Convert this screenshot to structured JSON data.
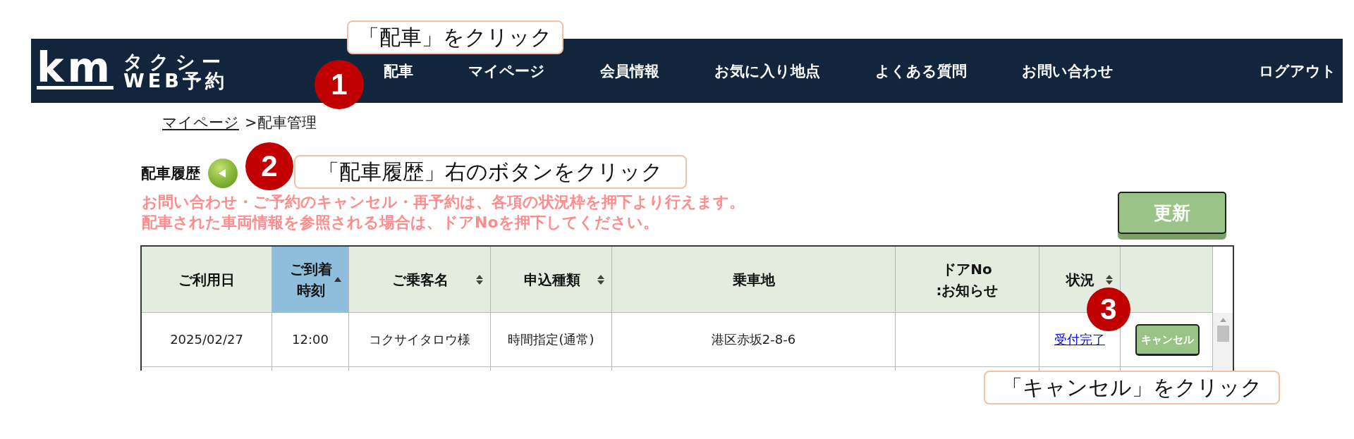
{
  "header": {
    "logo": {
      "mark": "km",
      "lines": [
        "タクシー",
        "WEB予約"
      ]
    },
    "nav": [
      {
        "label": "配車"
      },
      {
        "label": "マイページ"
      },
      {
        "label": "会員情報"
      },
      {
        "label": "お気に入り地点"
      },
      {
        "label": "よくある質問"
      },
      {
        "label": "お問い合わせ"
      }
    ],
    "logout": "ログアウト"
  },
  "breadcrumb": [
    {
      "label": "マイページ",
      "link": true
    },
    {
      "label": ">配車管理",
      "link": false
    }
  ],
  "history": {
    "title": "配車履歴",
    "notes": [
      "お問い合わせ・ご予約のキャンセル・再予約は、各項の状況枠を押下より行えます。",
      "配車された車両情報を参照される場合は、ドアNoを押下してください。"
    ],
    "refresh_button": "更新"
  },
  "table": {
    "columns": [
      {
        "label": "ご利用日",
        "sortable": false,
        "sorted": false
      },
      {
        "label": "ご到着時刻",
        "sortable": true,
        "sorted": true
      },
      {
        "label": "ご乗客名",
        "sortable": true,
        "sorted": false
      },
      {
        "label": "申込種類",
        "sortable": true,
        "sorted": false
      },
      {
        "label": "乗車地",
        "sortable": false,
        "sorted": false
      },
      {
        "label": "ドアNo\n:お知らせ",
        "sortable": false,
        "sorted": false
      },
      {
        "label": "状況",
        "sortable": true,
        "sorted": false
      }
    ],
    "rows": [
      {
        "date": "2025/02/27",
        "arrival_time": "12:00",
        "passenger": "コクサイタロウ様",
        "request_type": "時間指定(通常)",
        "pickup": "港区赤坂2-8-6",
        "status": "受付完了",
        "action": "キャンセル"
      }
    ]
  },
  "annotations": [
    {
      "number": "1",
      "text": "「配車」をクリック"
    },
    {
      "number": "2",
      "text": "「配車履歴」右のボタンをクリック"
    },
    {
      "number": "3",
      "text": "「キャンセル」をクリック"
    }
  ]
}
